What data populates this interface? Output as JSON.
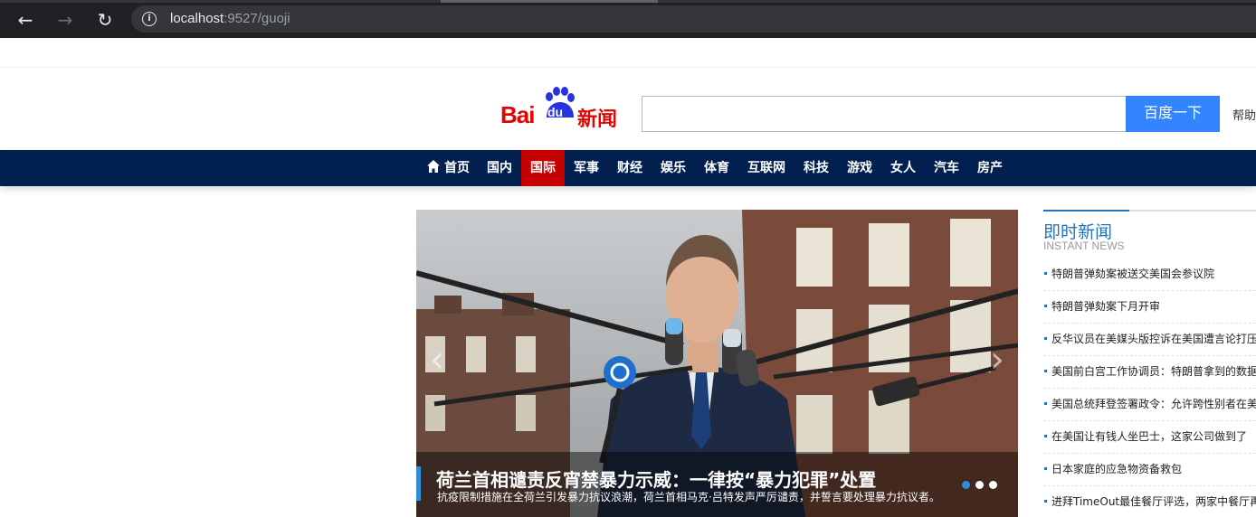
{
  "browser": {
    "back_icon": "arrow-left-icon",
    "forward_icon": "arrow-right-icon",
    "reload_icon": "reload-icon",
    "site_info_icon": "info-circle-icon",
    "url_host": "localhost",
    "url_rest": ":9527/guoji"
  },
  "header": {
    "logo_bai": "Bai",
    "logo_du": "du",
    "logo_news": "新闻",
    "search_value": "",
    "search_button": "百度一下",
    "help_link": "帮助"
  },
  "nav": {
    "home_icon": "home-icon",
    "items": [
      "首页",
      "国内",
      "国际",
      "军事",
      "财经",
      "娱乐",
      "体育",
      "互联网",
      "科技",
      "游戏",
      "女人",
      "汽车",
      "房产"
    ],
    "active": "国际",
    "colors": {
      "bar": "#01204f",
      "active": "#c40000"
    }
  },
  "carousel": {
    "prev_arrow": "‹",
    "next_arrow": "›",
    "title": "荷兰首相谴责反宵禁暴力示威：一律按“暴力犯罪”处置",
    "subtitle": "抗疫限制措施在全荷兰引发暴力抗议浪潮，荷兰首相马克·吕特发声严厉谴责，并誓言要处理暴力抗议者。",
    "slide_count": 3,
    "active_slide": 1
  },
  "instant_news": {
    "title": "即时新闻",
    "subtitle": "INSTANT NEWS",
    "items": [
      "特朗普弹劾案被送交美国会参议院",
      "特朗普弹劾案下月开审",
      "反华议员在美媒头版控诉在美国遭言论打压",
      "美国前白宫工作协调员：特朗普拿到的数据",
      "美国总统拜登签署政令：允许跨性别者在美",
      "在美国让有钱人坐巴士，这家公司做到了",
      "日本家庭的应急物资备救包",
      "进拜TimeOut最佳餐厅评选，两家中餐厅再"
    ]
  }
}
